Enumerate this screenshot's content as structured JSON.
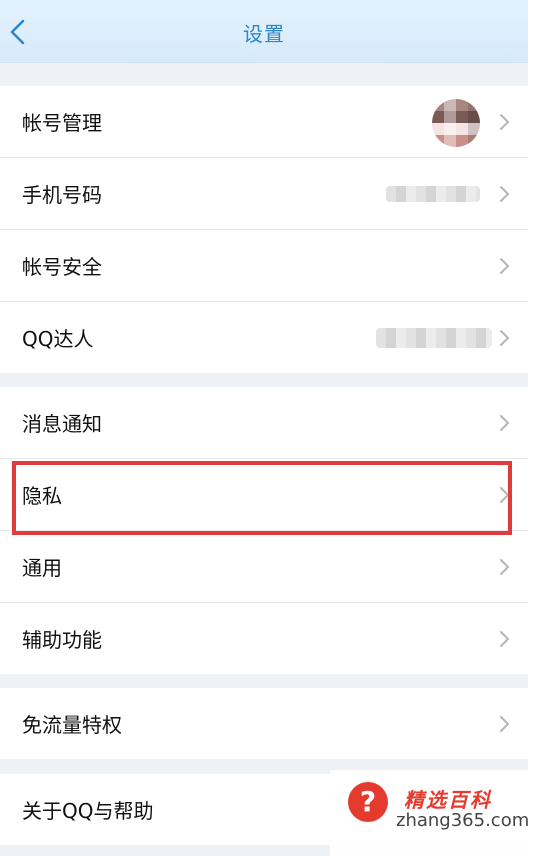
{
  "header": {
    "title": "设置",
    "back_icon": "chevron-left-icon"
  },
  "groups": [
    {
      "items": [
        {
          "label": "帐号管理",
          "value": "avatar (pixelated)"
        },
        {
          "label": "手机号码",
          "value": "(blurred)"
        },
        {
          "label": "帐号安全"
        },
        {
          "label": "QQ达人",
          "value": "(blurred)"
        }
      ]
    },
    {
      "items": [
        {
          "label": "消息通知"
        },
        {
          "label": "隐私",
          "highlighted": true
        },
        {
          "label": "通用"
        },
        {
          "label": "辅助功能"
        }
      ]
    },
    {
      "items": [
        {
          "label": "免流量特权"
        }
      ]
    },
    {
      "items": [
        {
          "label": "关于QQ与帮助"
        }
      ]
    }
  ],
  "watermark": {
    "icon": "question-mark-icon",
    "icon_text": "?",
    "title": "精选百科",
    "domain": "zhang365.com"
  },
  "colors": {
    "accent": "#2c86c9",
    "highlight": "#e13c3c",
    "background": "#eef1f5"
  }
}
